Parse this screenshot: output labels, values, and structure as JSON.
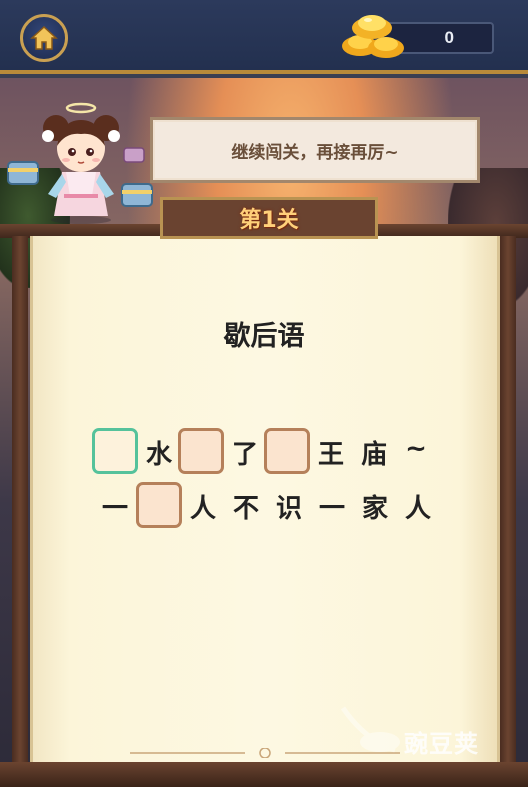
{
  "header": {
    "coin_count": "0"
  },
  "dialog": {
    "text": "继续闯关，再接再厉~"
  },
  "level": {
    "label": "第1关"
  },
  "puzzle": {
    "category": "歇后语",
    "line1": [
      "",
      "水",
      "",
      "了",
      "",
      "王",
      "庙",
      "~"
    ],
    "line2": [
      "一",
      "",
      "人",
      "不",
      "识",
      "一",
      "家",
      "人"
    ]
  },
  "watermark": {
    "text": "豌豆荚"
  },
  "colors": {
    "active_cell_border": "#55c29b",
    "cell_border": "#b5805a",
    "level_text": "#ffd07a"
  }
}
